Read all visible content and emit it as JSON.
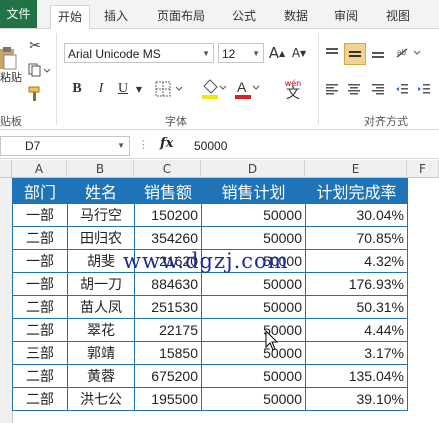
{
  "tabs": {
    "file": "文件",
    "home": "开始",
    "insert": "插入",
    "page_layout": "页面布局",
    "formulas": "公式",
    "data": "数据",
    "review": "审阅",
    "view": "视图"
  },
  "ribbon": {
    "paste_partial": "粘贴",
    "clipboard_label_partial": "贴板",
    "font_name": "Arial Unicode MS",
    "font_size": "12",
    "bold": "B",
    "italic": "I",
    "underline": "U",
    "grow_font": "A",
    "shrink_font": "A",
    "font_group_label": "字体",
    "alignment_group_label": "对齐方式",
    "wen_label": "wén",
    "wen_char": "文",
    "font_color": "#e02020",
    "fill_color": "#f5e600"
  },
  "formula_bar": {
    "name_box": "D7",
    "fx": "fx",
    "value": "50000"
  },
  "columns": [
    "A",
    "B",
    "C",
    "D",
    "E",
    "F"
  ],
  "table": {
    "headers": [
      "部门",
      "姓名",
      "销售额",
      "销售计划",
      "计划完成率"
    ],
    "rows": [
      [
        "一部",
        "马行空",
        "150200",
        "50000",
        "30.04%"
      ],
      [
        "二部",
        "田归农",
        "354260",
        "50000",
        "70.85%"
      ],
      [
        "一部",
        "胡斐",
        "21620",
        "50000",
        "4.32%"
      ],
      [
        "一部",
        "胡一刀",
        "884630",
        "50000",
        "176.93%"
      ],
      [
        "二部",
        "苗人凤",
        "251530",
        "50000",
        "50.31%"
      ],
      [
        "二部",
        "翠花",
        "22175",
        "50000",
        "4.44%"
      ],
      [
        "三部",
        "郭靖",
        "15850",
        "50000",
        "3.17%"
      ],
      [
        "二部",
        "黄蓉",
        "675200",
        "50000",
        "135.04%"
      ],
      [
        "二部",
        "洪七公",
        "195500",
        "50000",
        "39.10%"
      ]
    ]
  },
  "watermark": "www.dgzj.com"
}
